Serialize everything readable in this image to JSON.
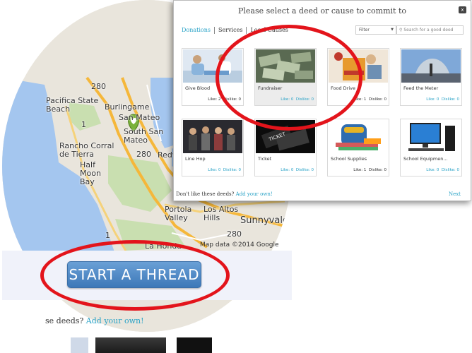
{
  "map": {
    "labels": [
      "280",
      "Burlingame",
      "San Mateo",
      "South San Mateo",
      "Pacifica State Beach",
      "Rancho Corral de Tierra",
      "Half Moon Bay",
      "280",
      "Redw",
      "Portola Valley",
      "Los Altos Hills",
      "Sunnyvale",
      "La Honda",
      "280",
      "1",
      "1",
      "Map data ©2014 Google"
    ],
    "marker": "heart-map-marker"
  },
  "thread_button": {
    "label": "START A THREAD"
  },
  "bottom": {
    "text": "se deeds?",
    "link": "Add your own!"
  },
  "modal": {
    "title": "Please select a deed or cause to commit to",
    "close": "x",
    "tabs": [
      "Donations",
      "Services",
      "Local Causes"
    ],
    "filter": {
      "label": "Filter"
    },
    "search": {
      "placeholder": "Search for a good deed"
    },
    "cards": [
      {
        "title": "Give Blood",
        "like": "Like: 2",
        "dislike": "Dislike: 0",
        "style": "plain"
      },
      {
        "title": "Fundraiser",
        "like": "Like: 0",
        "dislike": "Dislike: 0",
        "style": "link"
      },
      {
        "title": "Food Drive",
        "like": "Like: 1",
        "dislike": "Dislike: 0",
        "style": "plain"
      },
      {
        "title": "Feed the Meter",
        "like": "Like: 0",
        "dislike": "Dislike: 0",
        "style": "link"
      },
      {
        "title": "Line Hop",
        "like": "Like: 0",
        "dislike": "Dislike: 0",
        "style": "link"
      },
      {
        "title": "Ticket",
        "like": "Like: 0",
        "dislike": "Dislike: 0",
        "style": "link"
      },
      {
        "title": "School Supplies",
        "like": "Like: 1",
        "dislike": "Dislike: 0",
        "style": "plain"
      },
      {
        "title": "School Equipmen...",
        "like": "Like: 0",
        "dislike": "Dislike: 0",
        "style": "link"
      }
    ],
    "footer": {
      "question": "Don't like these deeds?",
      "link": "Add your own!"
    },
    "next": "Next"
  },
  "colors": {
    "accent": "#2aa3c7",
    "annotation_red": "#e3141b",
    "button_blue": "#4a86c5"
  }
}
